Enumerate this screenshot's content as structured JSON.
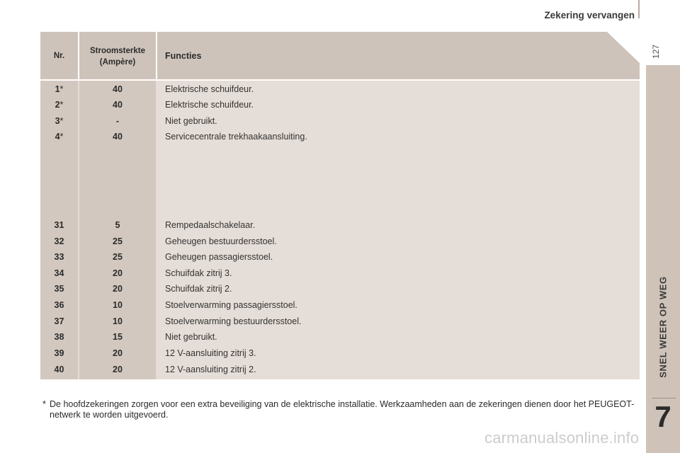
{
  "header": {
    "title": "Zekering vervangen",
    "page_number": "127"
  },
  "side_tab": {
    "chapter_label": "SNEL WEER OP WEG",
    "chapter_number": "7"
  },
  "table": {
    "headers": {
      "nr": "Nr.",
      "amp_line1": "Stroomsterkte",
      "amp_line2": "(Ampère)",
      "func": "Functies"
    },
    "rows": [
      {
        "nr": "1",
        "mark": "*",
        "amp": "40",
        "func": "Elektrische schuifdeur."
      },
      {
        "nr": "2",
        "mark": "*",
        "amp": "40",
        "func": "Elektrische schuifdeur."
      },
      {
        "nr": "3",
        "mark": "*",
        "amp": "-",
        "func": "Niet gebruikt."
      },
      {
        "nr": "4",
        "mark": "*",
        "amp": "40",
        "func": "Servicecentrale trekhaakaansluiting."
      },
      {
        "nr": "31",
        "mark": "",
        "amp": "5",
        "func": "Rempedaalschakelaar."
      },
      {
        "nr": "32",
        "mark": "",
        "amp": "25",
        "func": "Geheugen bestuurdersstoel."
      },
      {
        "nr": "33",
        "mark": "",
        "amp": "25",
        "func": "Geheugen passagiersstoel."
      },
      {
        "nr": "34",
        "mark": "",
        "amp": "20",
        "func": "Schuifdak zitrij 3."
      },
      {
        "nr": "35",
        "mark": "",
        "amp": "20",
        "func": "Schuifdak zitrij 2."
      },
      {
        "nr": "36",
        "mark": "",
        "amp": "10",
        "func": "Stoelverwarming passagiersstoel."
      },
      {
        "nr": "37",
        "mark": "",
        "amp": "10",
        "func": "Stoelverwarming bestuurdersstoel."
      },
      {
        "nr": "38",
        "mark": "",
        "amp": "15",
        "func": "Niet gebruikt."
      },
      {
        "nr": "39",
        "mark": "",
        "amp": "20",
        "func": "12 V-aansluiting zitrij 3."
      },
      {
        "nr": "40",
        "mark": "",
        "amp": "20",
        "func": "12 V-aansluiting zitrij 2."
      }
    ]
  },
  "footnote": {
    "mark": "*",
    "text": "De hoofdzekeringen zorgen voor een extra beveiliging van de elektrische installatie. Werkzaamheden aan de zekeringen dienen door het PEUGEOT-netwerk te worden uitgevoerd."
  },
  "watermark": "carmanualsonline.info",
  "colors": {
    "header_bg": "#cec3ba",
    "body_bg": "#e5ddd7",
    "column_bg": "#d3c8bf",
    "side_tab": "#cfc3b9"
  }
}
